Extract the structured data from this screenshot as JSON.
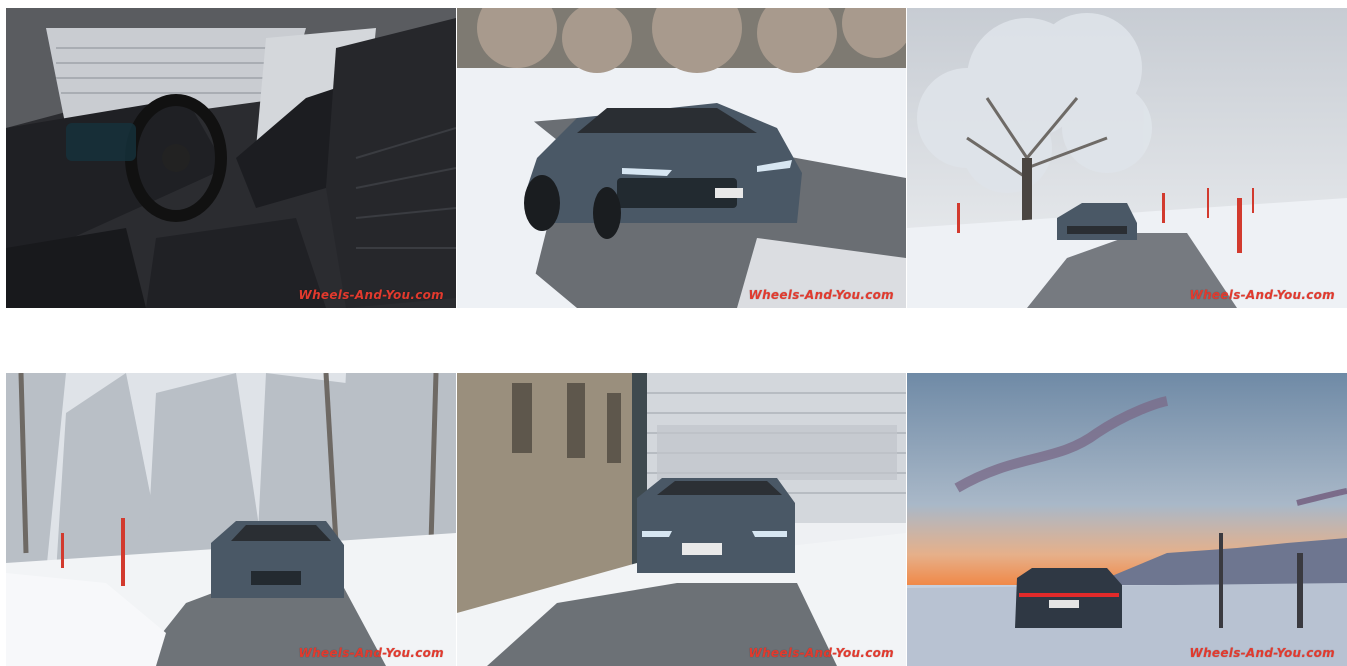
{
  "gallery": {
    "watermark": "Wheels-And-You.com",
    "photos": [
      {
        "subject": "car interior with steering wheel and quilted seats"
      },
      {
        "subject": "grey electric sports sedan on snowy road, front view"
      },
      {
        "subject": "car on snowy country road under frosted tree"
      },
      {
        "subject": "car on winding snowy forest road"
      },
      {
        "subject": "car parked in snow beside old building and garage door"
      },
      {
        "subject": "car at dusk on snowy field with sunset sky"
      }
    ]
  },
  "colors": {
    "watermark": "#e23a2e",
    "car_body": "#4a5866",
    "snow": "#eef1f5",
    "road": "#6a6e73",
    "sky_dusk": "#f08a4a"
  }
}
